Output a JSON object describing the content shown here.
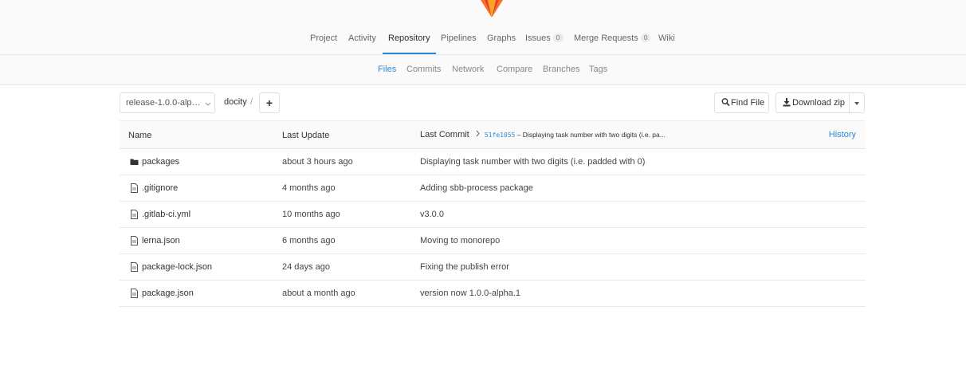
{
  "nav": {
    "items": [
      {
        "label": "Project"
      },
      {
        "label": "Activity"
      },
      {
        "label": "Repository",
        "active": true
      },
      {
        "label": "Pipelines"
      },
      {
        "label": "Graphs"
      },
      {
        "label": "Issues",
        "count": "0"
      },
      {
        "label": "Merge Requests",
        "count": "0"
      },
      {
        "label": "Wiki"
      }
    ]
  },
  "subnav": {
    "items": [
      {
        "label": "Files",
        "active": true
      },
      {
        "label": "Commits"
      },
      {
        "label": "Network"
      },
      {
        "label": "Compare"
      },
      {
        "label": "Branches"
      },
      {
        "label": "Tags"
      }
    ]
  },
  "toolbar": {
    "branch": "release-1.0.0-alph…",
    "path_root": "docity",
    "path_sep": "/",
    "add_label": "+",
    "find_file": "Find File",
    "download_zip": "Download zip"
  },
  "table": {
    "headers": {
      "name": "Name",
      "last_update": "Last Update",
      "last_commit": "Last Commit",
      "commit_sha": "51fe1055",
      "commit_msg": " – Displaying task number with two digits (i.e. pa...",
      "history": "History"
    },
    "rows": [
      {
        "type": "folder",
        "name": "packages",
        "updated": "about 3 hours ago",
        "message": "Displaying task number with two digits (i.e. padded with 0)"
      },
      {
        "type": "file",
        "name": ".gitignore",
        "updated": "4 months ago",
        "message": "Adding sbb-process package"
      },
      {
        "type": "file",
        "name": ".gitlab-ci.yml",
        "updated": "10 months ago",
        "message": "v3.0.0"
      },
      {
        "type": "file",
        "name": "lerna.json",
        "updated": "6 months ago",
        "message": "Moving to monorepo"
      },
      {
        "type": "file",
        "name": "package-lock.json",
        "updated": "24 days ago",
        "message": "Fixing the publish error"
      },
      {
        "type": "file",
        "name": "package.json",
        "updated": "about a month ago",
        "message": "version now 1.0.0-alpha.1"
      }
    ]
  },
  "colors": {
    "accent": "#2e87d6",
    "logo_orange": "#e24329",
    "logo_light": "#fca326"
  }
}
